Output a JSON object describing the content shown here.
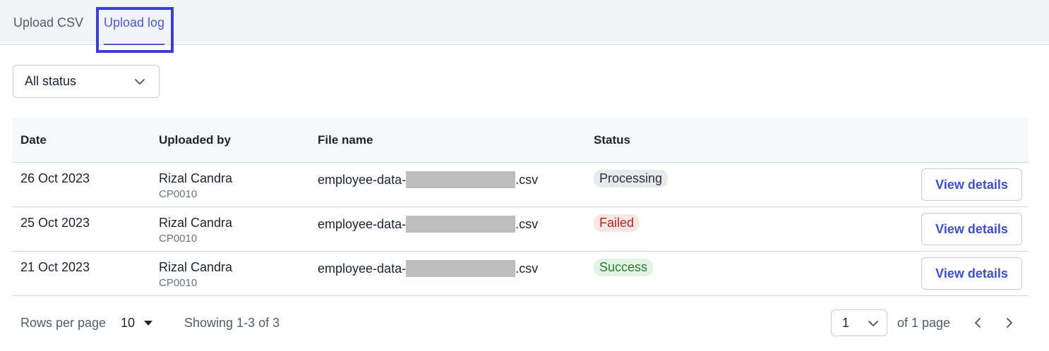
{
  "tabs": [
    {
      "label": "Upload CSV"
    },
    {
      "label": "Upload log"
    }
  ],
  "filter": {
    "value": "All status",
    "icon": "chevron-down-icon"
  },
  "table": {
    "headers": [
      "Date",
      "Uploaded by",
      "File name",
      "Status"
    ],
    "rows": [
      {
        "date": "26 Oct 2023",
        "user": "Rizal Candra",
        "user_id": "CP0010",
        "file_prefix": "employee-data-",
        "file_suffix": ".csv",
        "status": "Processing",
        "action": "View details"
      },
      {
        "date": "25 Oct 2023",
        "user": "Rizal Candra",
        "user_id": "CP0010",
        "file_prefix": "employee-data-",
        "file_suffix": ".csv",
        "status": "Failed",
        "action": "View details"
      },
      {
        "date": "21 Oct 2023",
        "user": "Rizal Candra",
        "user_id": "CP0010",
        "file_prefix": "employee-data-",
        "file_suffix": ".csv",
        "status": "Success",
        "action": "View details"
      }
    ]
  },
  "pagination": {
    "rows_per_page_label": "Rows per page",
    "rows_per_page_value": "10",
    "showing": "Showing 1-3 of 3",
    "page_value": "1",
    "of_pages": "of 1 page"
  },
  "colors": {
    "accent": "#4b5ad3",
    "focus_ring": "#3b3fcf",
    "processing": "#e7eaee",
    "failed": "#b3261e",
    "success": "#2e7d32"
  }
}
